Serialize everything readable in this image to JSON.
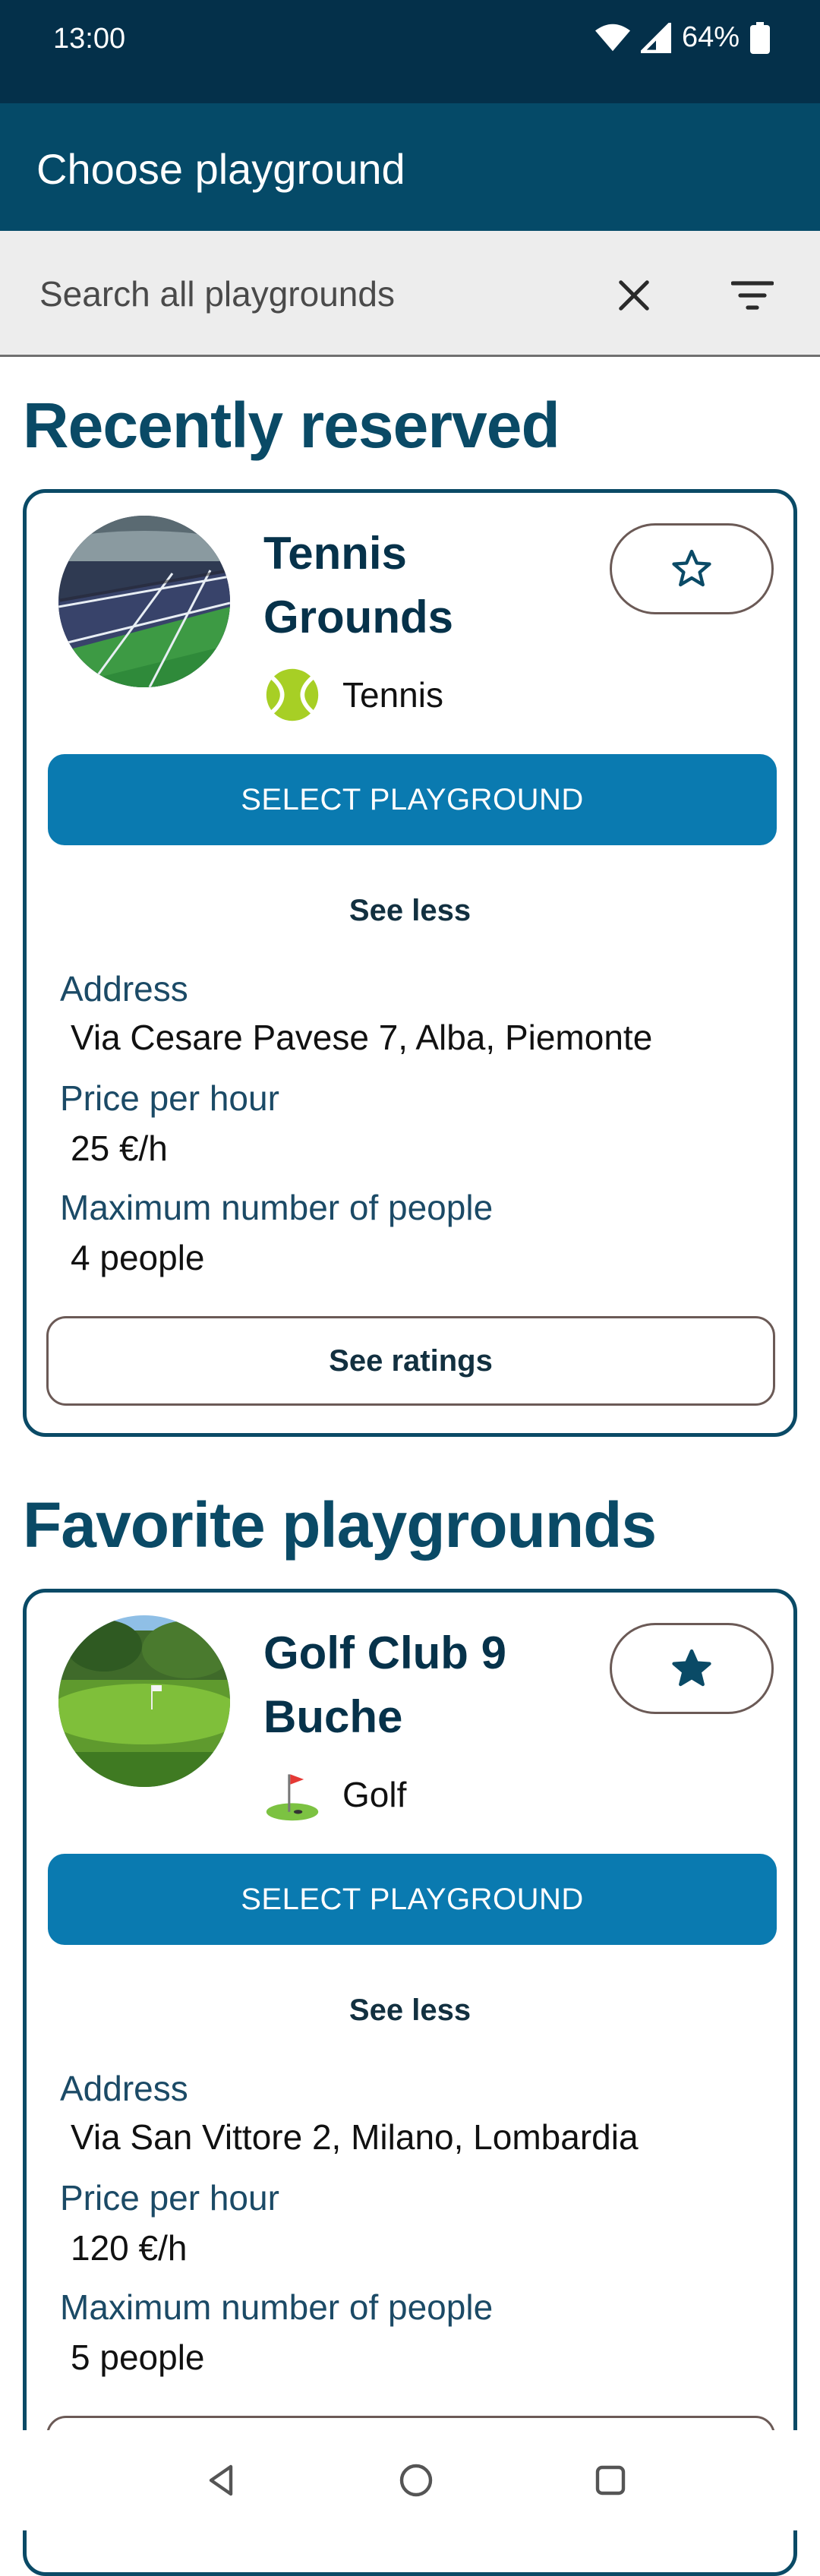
{
  "status_bar": {
    "time": "13:00",
    "battery": "64%"
  },
  "app_bar": {
    "title": "Choose playground"
  },
  "search": {
    "placeholder": "Search all playgrounds",
    "value": ""
  },
  "sections": {
    "recent_title": "Recently reserved",
    "favorite_title": "Favorite playgrounds"
  },
  "recent_card": {
    "name": "Tennis Grounds",
    "sport": "Tennis",
    "favorited": false,
    "select_label": "SELECT PLAYGROUND",
    "see_less_label": "See less",
    "address_label": "Address",
    "address": "Via Cesare Pavese 7, Alba, Piemonte",
    "price_label": "Price per hour",
    "price": "25 €/h",
    "max_label": "Maximum number of people",
    "max_people": "4 people",
    "ratings_label": "See ratings"
  },
  "favorite_card": {
    "name": "Golf Club 9 Buche",
    "sport": "Golf",
    "favorited": true,
    "select_label": "SELECT PLAYGROUND",
    "see_less_label": "See less",
    "address_label": "Address",
    "address": "Via San Vittore 2, Milano, Lombardia",
    "price_label": "Price per hour",
    "price": "120 €/h",
    "max_label": "Maximum number of people",
    "max_people": "5 people"
  },
  "colors": {
    "status_bar": "#04304a",
    "app_bar": "#054a68",
    "accent_button": "#0a7ab0",
    "heading": "#0a4a66"
  }
}
